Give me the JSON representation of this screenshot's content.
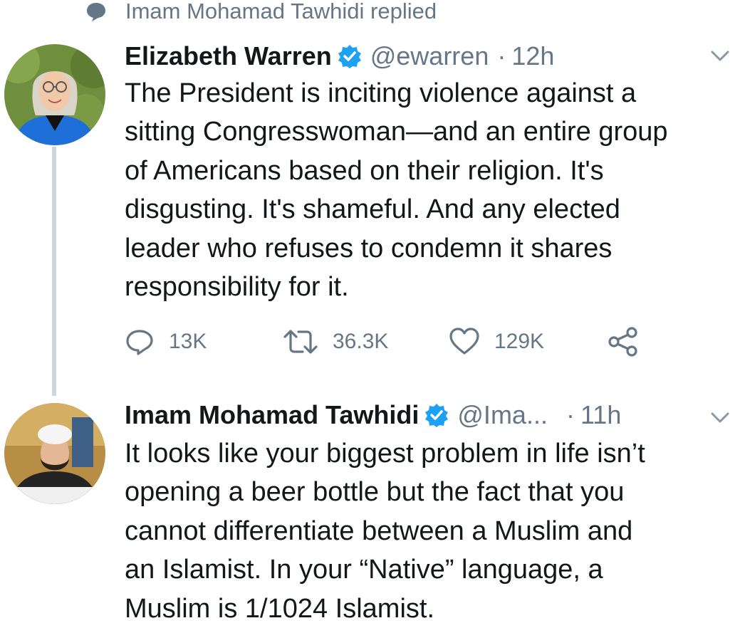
{
  "context": {
    "icon": "speech-bubble-icon",
    "text": "Imam Mohamad Tawhidi replied"
  },
  "tweets": [
    {
      "author_name": "Elizabeth Warren",
      "handle": "@ewarren",
      "separator": "·",
      "time": "12h",
      "verified": true,
      "text": "The President is inciting violence against a\nsitting Congresswoman—and an entire group\nof Americans based on their religion. It's\ndisgusting. It's shameful. And any elected\nleader who refuses to condemn it shares\nresponsibility for it.",
      "actions": {
        "replies": "13K",
        "retweets": "36.3K",
        "likes": "129K"
      }
    },
    {
      "author_name": "Imam Mohamad Tawhidi",
      "handle": "@Ima...",
      "separator": "·",
      "time": "11h",
      "verified": true,
      "text": "It looks like your biggest problem in life isn’t\nopening a beer bottle but the fact that you\ncannot differentiate between a Muslim and\nan Islamist. In your “Native” language, a\nMuslim is 1/1024 Islamist."
    }
  ],
  "colors": {
    "text": "#14171a",
    "secondary": "#657786",
    "verified": "#1da1f2",
    "thread_line": "#ccd6dd"
  }
}
